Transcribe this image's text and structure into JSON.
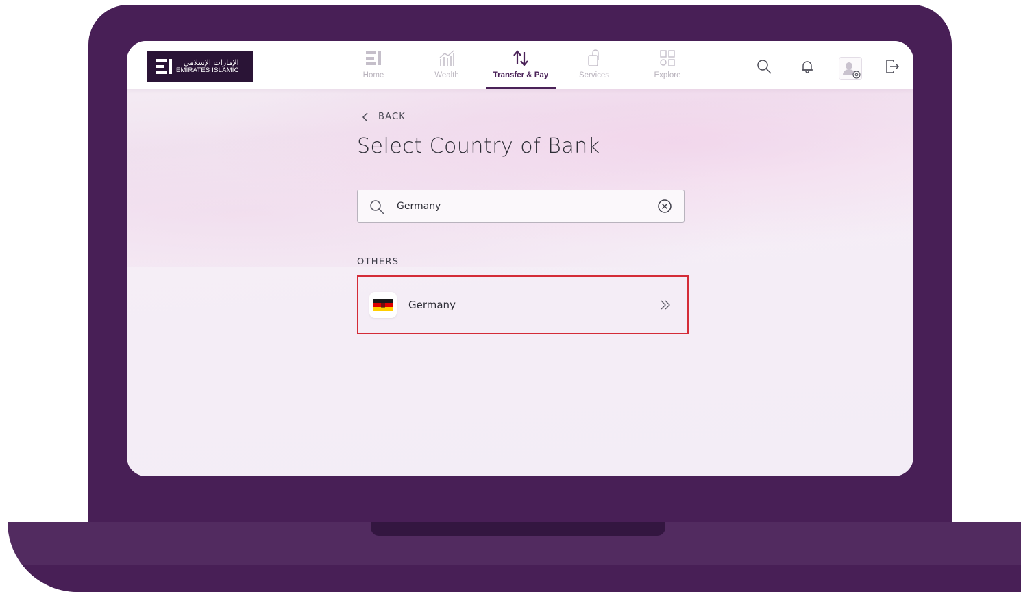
{
  "brand": {
    "logo_arabic": "الإمارات الإسلامي",
    "logo_english": "EMIRATES ISLAMIC"
  },
  "nav": {
    "items": [
      {
        "label": "Home",
        "icon": "home-icon",
        "active": false
      },
      {
        "label": "Wealth",
        "icon": "wealth-chart-icon",
        "active": false
      },
      {
        "label": "Transfer & Pay",
        "icon": "transfer-arrows-icon",
        "active": true
      },
      {
        "label": "Services",
        "icon": "services-icon",
        "active": false
      },
      {
        "label": "Explore",
        "icon": "explore-grid-icon",
        "active": false
      }
    ]
  },
  "header_actions": [
    "search-icon",
    "bell-icon",
    "profile-settings-icon",
    "logout-icon"
  ],
  "page": {
    "back_label": "BACK",
    "title": "Select Country of Bank"
  },
  "search": {
    "value": "Germany"
  },
  "results": {
    "section_label": "OTHERS",
    "items": [
      {
        "name": "Germany",
        "flag_colors": [
          "#1a1a1a",
          "#dd0000",
          "#ffce00"
        ]
      }
    ]
  },
  "colors": {
    "brand_purple": "#481f56",
    "accent": "#4a2258",
    "highlight": "#d42c38"
  }
}
